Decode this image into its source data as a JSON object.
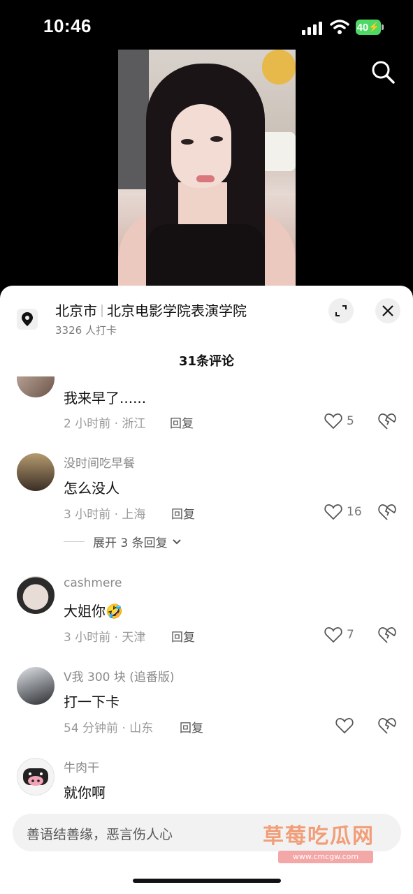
{
  "status_bar": {
    "time": "10:46",
    "battery": "40"
  },
  "location": {
    "city": "北京市",
    "place": "北京电影学院表演学院",
    "checkins": "3326 人打卡"
  },
  "comments_header": "31条评论",
  "comments": [
    {
      "username": "",
      "text": "我来早了......",
      "meta": "2 小时前 · 浙江",
      "reply": "回复",
      "likes": "5"
    },
    {
      "username": "没时间吃早餐",
      "text": "怎么没人",
      "meta": "3 小时前 · 上海",
      "reply": "回复",
      "likes": "16",
      "expand": "展开 3 条回复"
    },
    {
      "username": "cashmere",
      "text": "大姐你",
      "emoji": "🤣",
      "meta": "3 小时前 · 天津",
      "reply": "回复",
      "likes": "7"
    },
    {
      "username": "V我 300 块 (追番版)",
      "text": "打一下卡",
      "meta": "54 分钟前 · 山东",
      "reply": "回复",
      "likes": ""
    },
    {
      "username": "牛肉干",
      "text": "就你啊",
      "meta": "",
      "reply": "",
      "likes": ""
    }
  ],
  "input": {
    "placeholder": "善语结善缘，恶言伤人心"
  },
  "watermark": {
    "text": "草莓吃瓜网",
    "sub": "www.cmcgw.com"
  },
  "colors": {
    "background": "#000000",
    "sheet": "#ffffff",
    "battery": "#4cd964",
    "meta_text": "#9a9a9a"
  }
}
